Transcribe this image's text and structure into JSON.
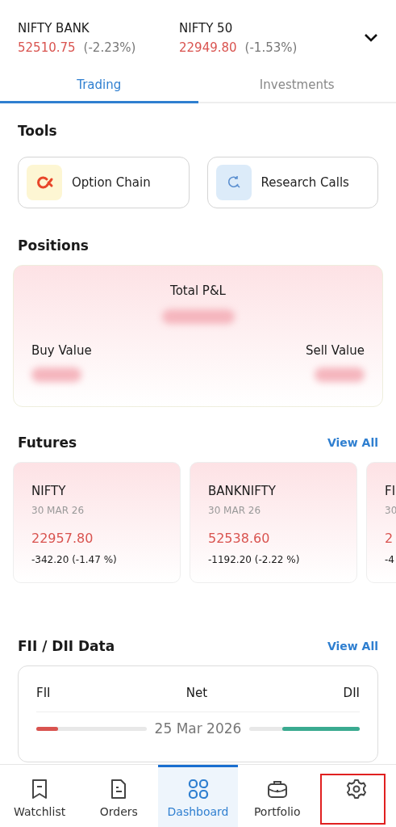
{
  "indices": [
    {
      "name": "NIFTY BANK",
      "value": "52510.75",
      "change": "(-2.23%)"
    },
    {
      "name": "NIFTY 50",
      "value": "22949.80",
      "change": "(-1.53%)"
    }
  ],
  "tabs": [
    {
      "label": "Trading",
      "selected": true
    },
    {
      "label": "Investments",
      "selected": false
    }
  ],
  "tools": {
    "title": "Tools",
    "items": [
      {
        "label": "Option Chain",
        "kind": "option"
      },
      {
        "label": "Research Calls",
        "kind": "research"
      }
    ]
  },
  "positions": {
    "title": "Positions",
    "total_label": "Total P&L",
    "buy_label": "Buy Value",
    "sell_label": "Sell Value"
  },
  "futures": {
    "title": "Futures",
    "link": "View All",
    "cards": [
      {
        "name": "NIFTY",
        "expiry": "30 MAR 26",
        "price": "22957.80",
        "change": "-342.20 (-1.47 %)"
      },
      {
        "name": "BANKNIFTY",
        "expiry": "30 MAR 26",
        "price": "52538.60",
        "change": "-1192.20 (-2.22 %)"
      },
      {
        "name": "FI",
        "expiry": "30",
        "price": "2",
        "change": "-4"
      }
    ]
  },
  "fii_dii": {
    "title": "FII / DII Data",
    "link": "View All",
    "left": "FII",
    "middle": "Net",
    "right": "DII",
    "date": "25 Mar 2026",
    "fii": {
      "level": 0.2
    },
    "dii": {
      "level": 0.7
    }
  },
  "nav": [
    {
      "label": "Watchlist",
      "kind": "watchlist",
      "selected": false
    },
    {
      "label": "Orders",
      "kind": "orders",
      "selected": false
    },
    {
      "label": "Dashboard",
      "kind": "dashboard",
      "selected": true
    },
    {
      "label": "Portfolio",
      "kind": "portfolio",
      "selected": false
    },
    {
      "kind": "settings",
      "selected": false,
      "highlighted": true
    }
  ]
}
